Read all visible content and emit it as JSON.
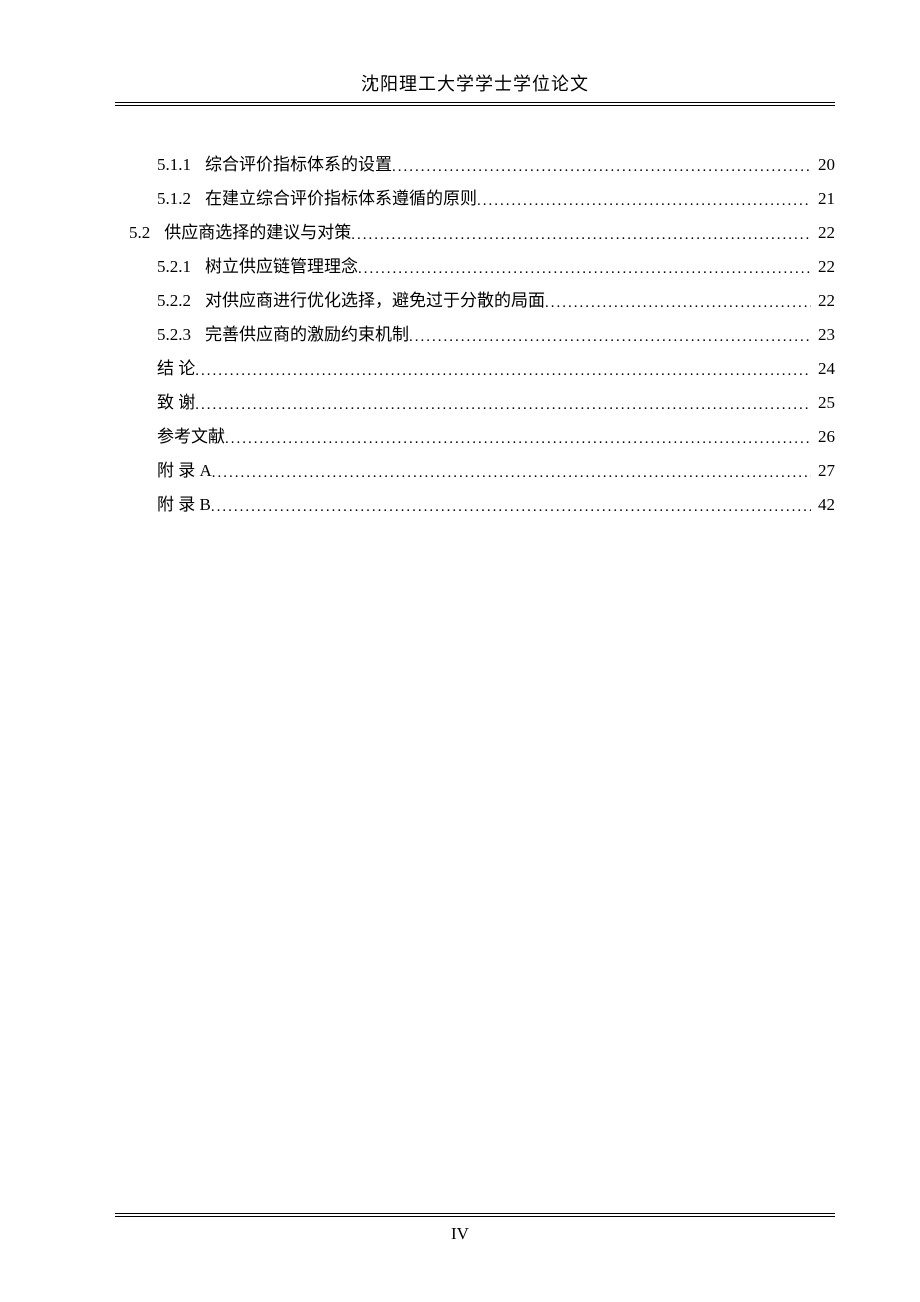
{
  "header": "沈阳理工大学学士学位论文",
  "page_number": "IV",
  "toc": [
    {
      "indent": 2,
      "num": "5.1.1",
      "title": "综合评价指标体系的设置",
      "page": "20",
      "spaced": false
    },
    {
      "indent": 2,
      "num": "5.1.2",
      "title": "在建立综合评价指标体系遵循的原则",
      "page": "21",
      "spaced": false
    },
    {
      "indent": 1,
      "num": "5.2",
      "title": "供应商选择的建议与对策",
      "page": "22",
      "spaced": false
    },
    {
      "indent": 2,
      "num": "5.2.1",
      "title": "树立供应链管理理念",
      "page": "22",
      "spaced": false
    },
    {
      "indent": 2,
      "num": "5.2.2",
      "title": "对供应商进行优化选择，避免过于分散的局面",
      "page": "22",
      "spaced": false
    },
    {
      "indent": 2,
      "num": "5.2.3",
      "title": "完善供应商的激励约束机制",
      "page": "23",
      "spaced": false
    },
    {
      "indent": 3,
      "num": "",
      "title": "结 论",
      "page": "24",
      "spaced": false
    },
    {
      "indent": 3,
      "num": "",
      "title": "致 谢",
      "page": "25",
      "spaced": false
    },
    {
      "indent": 3,
      "num": "",
      "title": "参考文献",
      "page": "26",
      "spaced": false
    },
    {
      "indent": 3,
      "num": "",
      "title": "附 录 A",
      "page": "27",
      "spaced": false
    },
    {
      "indent": 3,
      "num": "",
      "title": "附 录 B",
      "page": "42",
      "spaced": false
    }
  ]
}
